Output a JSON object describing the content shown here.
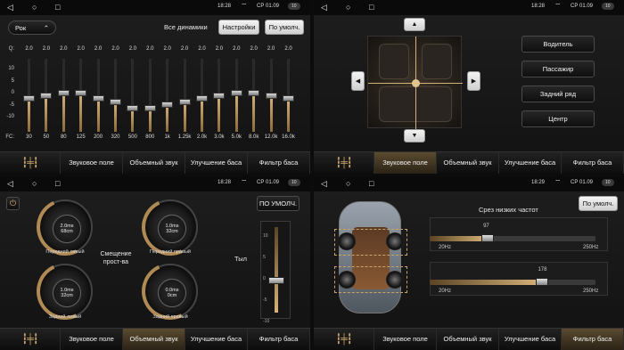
{
  "status": {
    "time_1": "18:28",
    "time_2": "18:28",
    "time_3": "18:28",
    "time_4": "18:29",
    "date": "СР 01.09",
    "battery": "10"
  },
  "tabs": [
    "Звуковое поле",
    "Объемный звук",
    "Улучшение баса",
    "Фильтр баса"
  ],
  "eq": {
    "preset": "Рок",
    "preset_icon": "chevron-up-icon",
    "all_speakers": "Все динамики",
    "settings_btn": "Настройки",
    "default_btn": "По умолч.",
    "q_label": "Q:",
    "fc_label": "FC:",
    "y_ticks": [
      "10",
      "5",
      "0",
      "-5",
      "-10"
    ],
    "bands": [
      {
        "q": "2.0",
        "freq": "30",
        "gain": -1
      },
      {
        "q": "2.0",
        "freq": "50",
        "gain": 0
      },
      {
        "q": "2.0",
        "freq": "80",
        "gain": 1
      },
      {
        "q": "2.0",
        "freq": "125",
        "gain": 1
      },
      {
        "q": "2.0",
        "freq": "200",
        "gain": -1
      },
      {
        "q": "2.0",
        "freq": "320",
        "gain": -2
      },
      {
        "q": "2.0",
        "freq": "500",
        "gain": -4
      },
      {
        "q": "2.0",
        "freq": "800",
        "gain": -4
      },
      {
        "q": "2.0",
        "freq": "1k",
        "gain": -3
      },
      {
        "q": "2.0",
        "freq": "1.25k",
        "gain": -2
      },
      {
        "q": "2.0",
        "freq": "2.0k",
        "gain": -1
      },
      {
        "q": "2.0",
        "freq": "3.0k",
        "gain": 0
      },
      {
        "q": "2.0",
        "freq": "5.0k",
        "gain": 1
      },
      {
        "q": "2.0",
        "freq": "8.0k",
        "gain": 1
      },
      {
        "q": "2.0",
        "freq": "12.0k",
        "gain": 0
      },
      {
        "q": "2.0",
        "freq": "16.0k",
        "gain": -1
      }
    ]
  },
  "seat": {
    "driver": "Водитель",
    "passenger": "Пассажир",
    "rear": "Задний ряд",
    "center": "Центр"
  },
  "delay": {
    "default_btn": "ПО УМОЛЧ.",
    "center_label": "Смещение прост-ва",
    "rear_label": "Тыл",
    "dials": [
      {
        "name": "Передний левый",
        "ms": "2.0ms",
        "cm": "68cm"
      },
      {
        "name": "Передний правый",
        "ms": "1.0ms",
        "cm": "32cm"
      },
      {
        "name": "Задний левый",
        "ms": "1.0ms",
        "cm": "32cm"
      },
      {
        "name": "Задний правый",
        "ms": "0.0ms",
        "cm": "0cm"
      }
    ],
    "scale_ticks": [
      "-10",
      "-5",
      "0",
      "5",
      "10"
    ]
  },
  "filter": {
    "title": "Срез низких частот",
    "default_btn": "По умолч.",
    "slider1_value": "97",
    "slider1_level": 0.35,
    "slider2_value": "178",
    "slider2_level": 0.68,
    "min_label": "20Hz",
    "max_label": "250Hz"
  }
}
